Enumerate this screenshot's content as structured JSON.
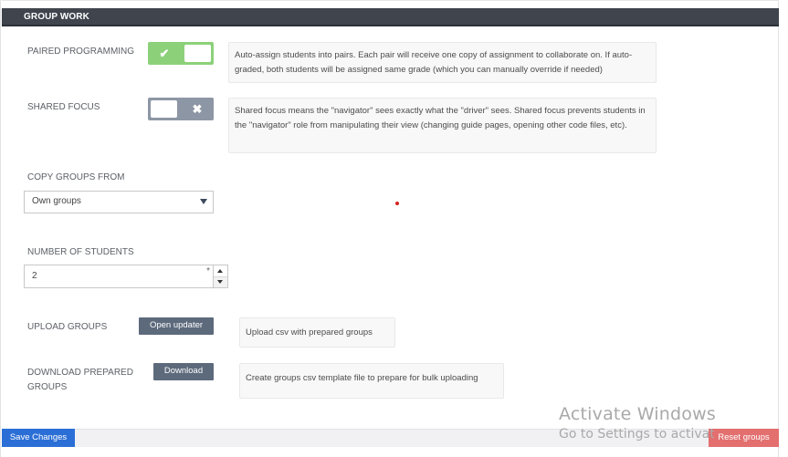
{
  "section": {
    "title": "GROUP WORK"
  },
  "paired_programming": {
    "label": "PAIRED PROGRAMMING",
    "toggle_state": "on",
    "toggle_glyph": "✔",
    "info": "Auto-assign students into pairs. Each pair will receive one copy of assignment to collaborate on. If auto-graded, both students will be assigned same grade (which you can manually override if needed)"
  },
  "shared_focus": {
    "label": "SHARED FOCUS",
    "toggle_state": "off",
    "toggle_glyph": "✖",
    "info": "Shared focus means the \"navigator\" sees exactly what the \"driver\" sees. Shared focus prevents students in the \"navigator\" role from manipulating their view (changing guide pages, opening other code files, etc)."
  },
  "copy_groups": {
    "label": "COPY GROUPS FROM",
    "selected": "Own groups"
  },
  "number_of_students": {
    "label": "NUMBER OF STUDENTS",
    "value": "2",
    "required_mark": "*"
  },
  "upload_groups": {
    "label": "UPLOAD GROUPS",
    "button_label": "Open updater",
    "info": "Upload csv with prepared groups"
  },
  "download_groups": {
    "label_line1": "DOWNLOAD PREPARED",
    "label_line2": "GROUPS",
    "button_label": "Download",
    "info": "Create groups csv template file to prepare for bulk uploading"
  },
  "footer": {
    "save_label": "Save Changes",
    "reset_label": "Reset groups"
  },
  "watermark": {
    "line1": "Activate Windows",
    "line2": "Go to Settings to activate Windows."
  },
  "colors": {
    "header": "#3f444d",
    "toggle_on": "#8cd17a",
    "toggle_off": "#8d96a4",
    "save_button": "#2b6fd6",
    "reset_button": "#e36f6f",
    "dark_button": "#5d6a7c"
  }
}
